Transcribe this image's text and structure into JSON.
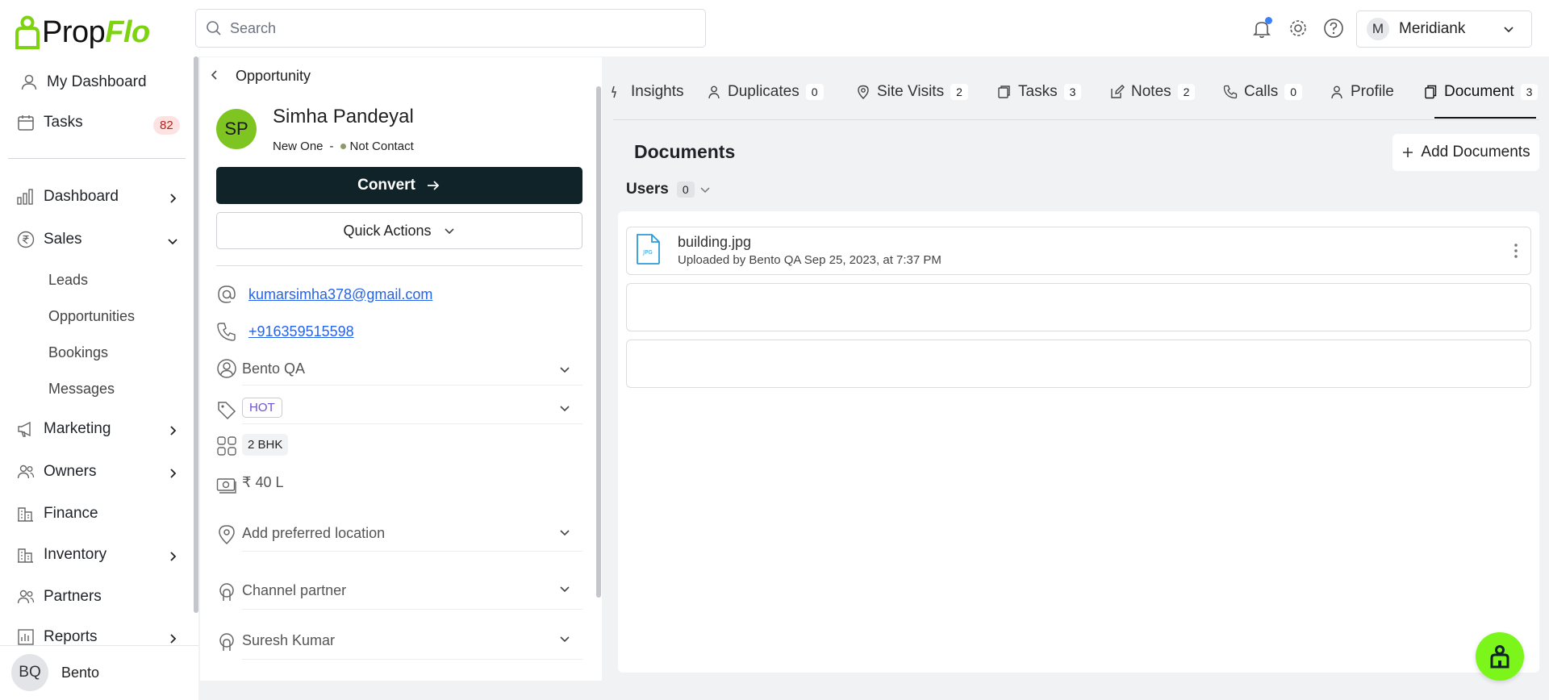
{
  "brand": {
    "logo_left": "Prop",
    "logo_right": "Flo",
    "accent": "#7dd30f"
  },
  "search": {
    "placeholder": "Search"
  },
  "topbar": {
    "org_initial": "M",
    "org_name": "Meridiank",
    "notification_dot_color": "#3b82f6"
  },
  "sidebar": {
    "my_dashboard": "My Dashboard",
    "tasks": "Tasks",
    "tasks_badge": "82",
    "dashboard": "Dashboard",
    "sales": "Sales",
    "sales_sub": [
      "Leads",
      "Opportunities",
      "Bookings",
      "Messages"
    ],
    "marketing": "Marketing",
    "owners": "Owners",
    "finance": "Finance",
    "inventory": "Inventory",
    "partners": "Partners",
    "reports": "Reports",
    "user_initials": "BQ",
    "user_name": "Bento"
  },
  "lead": {
    "breadcrumb": "Opportunity",
    "initials": "SP",
    "name": "Simha Pandeyal",
    "stage": "New One",
    "separator": "-",
    "status": "Not Contact",
    "convert_label": "Convert",
    "quick_actions_label": "Quick Actions",
    "email": "kumarsimha378@gmail.com",
    "phone": "+916359515598",
    "owner": "Bento QA",
    "tag": "HOT",
    "configuration": "2 BHK",
    "budget": "₹ 40 L",
    "location_placeholder": "Add preferred location",
    "channel_partner_placeholder": "Channel partner",
    "assignee": "Suresh Kumar"
  },
  "tabs": [
    {
      "label": "Insights",
      "count": null,
      "icon": "insights-icon"
    },
    {
      "label": "Duplicates",
      "count": "0",
      "icon": "person-icon"
    },
    {
      "label": "Site Visits",
      "count": "2",
      "icon": "map-pin-icon"
    },
    {
      "label": "Tasks",
      "count": "3",
      "icon": "task-icon"
    },
    {
      "label": "Notes",
      "count": "2",
      "icon": "pencil-icon"
    },
    {
      "label": "Calls",
      "count": "0",
      "icon": "phone-icon"
    },
    {
      "label": "Profile",
      "count": null,
      "icon": "person-icon"
    },
    {
      "label": "Document",
      "count": "3",
      "icon": "document-icon",
      "active": true
    }
  ],
  "documents": {
    "title": "Documents",
    "add_label": "Add Documents",
    "users_filter_label": "Users",
    "users_filter_count": "0",
    "items": [
      {
        "file_name": "building.jpg",
        "file_type": "JPG",
        "meta": "Uploaded by Bento QA Sep 25, 2023, at 7:37 PM"
      }
    ]
  }
}
